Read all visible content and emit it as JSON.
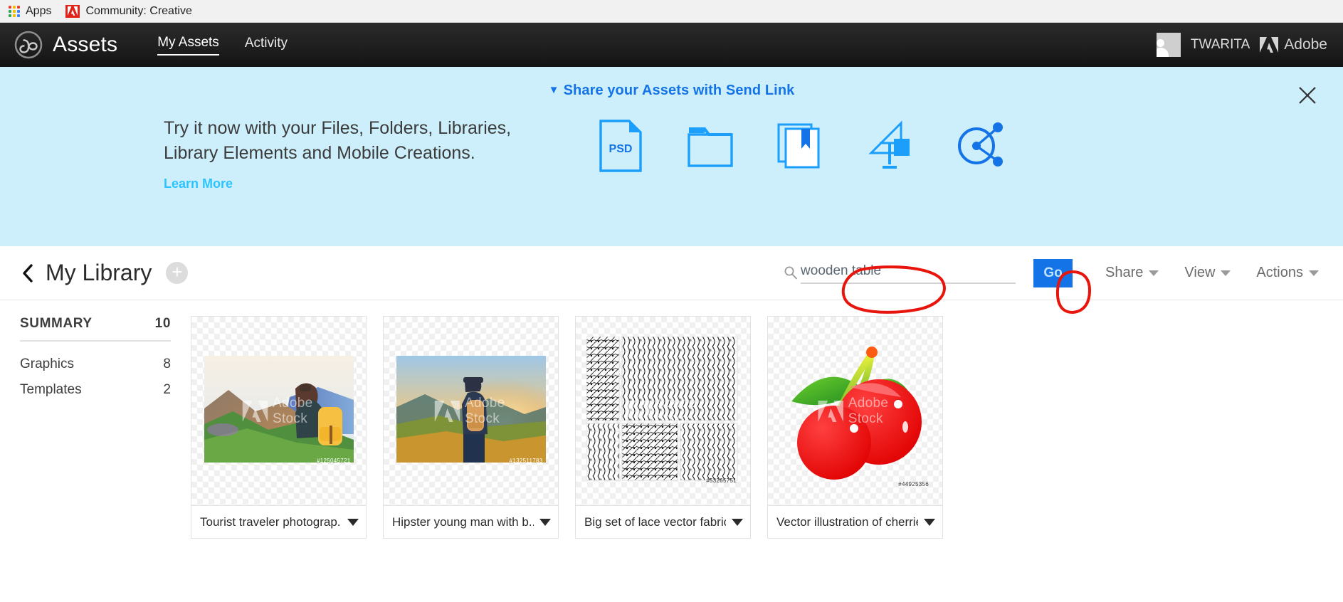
{
  "browser": {
    "bookmarks": [
      {
        "label": "Apps",
        "icon": "apps-grid-icon"
      },
      {
        "label": "Community: Creative",
        "icon": "adobe-logo-icon"
      }
    ]
  },
  "header": {
    "logo_icon": "creative-cloud-icon",
    "brand": "Assets",
    "nav": [
      {
        "label": "My Assets",
        "active": true
      },
      {
        "label": "Activity",
        "active": false
      }
    ],
    "user": {
      "name": "TWARITA",
      "avatar_icon": "user-avatar-icon"
    },
    "adobe": {
      "label": "Adobe",
      "icon": "adobe-logo-icon"
    }
  },
  "banner": {
    "headline": "Share your Assets with Send Link",
    "headline_caret": "▼",
    "body_line1": "Try it now with your Files, Folders, Libraries,",
    "body_line2": "Library Elements and Mobile Creations.",
    "learn_more": "Learn More",
    "close_icon": "close-icon",
    "accent_color": "#1473e6",
    "background_color": "#cdeffc",
    "icons": [
      {
        "name": "psd-file-icon",
        "label": "PSD"
      },
      {
        "name": "folder-icon",
        "label": ""
      },
      {
        "name": "library-icon",
        "label": ""
      },
      {
        "name": "library-element-icon",
        "label": ""
      },
      {
        "name": "mobile-creation-icon",
        "label": ""
      }
    ]
  },
  "toolbar": {
    "back_icon": "back-chevron-icon",
    "title": "My Library",
    "add_label": "+",
    "search": {
      "icon": "search-icon",
      "value": "wooden table",
      "placeholder": "Search"
    },
    "go_label": "Go",
    "go_color": "#1473e6",
    "menus": [
      {
        "label": "Share"
      },
      {
        "label": "View"
      },
      {
        "label": "Actions"
      }
    ]
  },
  "annotations": {
    "color": "#e8150c",
    "shapes": [
      {
        "name": "search-field-circle",
        "target": "search-input"
      },
      {
        "name": "go-button-circle",
        "target": "go-button"
      }
    ]
  },
  "sidebar": {
    "summary_label": "SUMMARY",
    "summary_count": "10",
    "items": [
      {
        "label": "Graphics",
        "count": "8"
      },
      {
        "label": "Templates",
        "count": "2"
      }
    ]
  },
  "assets": [
    {
      "title": "Tourist traveler photograp...",
      "watermark": "Adobe Stock",
      "stock_id": "#125045721",
      "thumb": "photo-hiker-mountains"
    },
    {
      "title": "Hipster young man with b...",
      "watermark": "Adobe Stock",
      "stock_id": "#132511783",
      "thumb": "photo-man-backpack-sunset"
    },
    {
      "title": "Big set of lace vector fabric...",
      "watermark": "Adobe Stock",
      "stock_id": "#53265751",
      "thumb": "lace-vector-grid"
    },
    {
      "title": "Vector illustration of cherries",
      "watermark": "Adobe Stock",
      "stock_id": "#44925356",
      "thumb": "cherries-illustration"
    }
  ]
}
